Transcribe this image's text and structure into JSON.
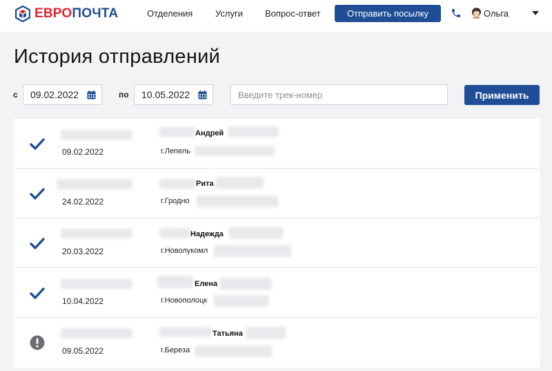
{
  "header": {
    "logo": {
      "part1": "ЕВРО",
      "part2": "ПОЧТА"
    },
    "nav": [
      {
        "label": "Отделения"
      },
      {
        "label": "Услуги"
      },
      {
        "label": "Вопрос-ответ"
      }
    ],
    "send_button": "Отправить посылку",
    "user_name": "Ольга",
    "icons": {
      "phone": "phone-icon",
      "avatar": "avatar-icon",
      "menu": "chevron-down-icon"
    }
  },
  "page_title": "История отправлений",
  "filters": {
    "from_label": "с",
    "from_date": "09.02.2022",
    "to_label": "по",
    "to_date": "10.05.2022",
    "track_placeholder": "Введите трек-номер",
    "apply_label": "Применить"
  },
  "shipments": [
    {
      "status": "delivered",
      "date": "09.02.2022",
      "name": "Андрей",
      "city": "г.Лепель"
    },
    {
      "status": "delivered",
      "date": "24.02.2022",
      "name": "Рита",
      "city": "г.Гродно"
    },
    {
      "status": "delivered",
      "date": "20.03.2022",
      "name": "Надежда",
      "city": "г.Новолукомл"
    },
    {
      "status": "delivered",
      "date": "10.04.2022",
      "name": "Елена",
      "city": "г.Новополоцк"
    },
    {
      "status": "attention",
      "date": "09.05.2022",
      "name": "Татьяна",
      "city": "г.Береза"
    }
  ],
  "colors": {
    "brand_blue": "#1f4e96",
    "brand_red": "#e0262e",
    "attention_gray": "#6b6f75"
  }
}
